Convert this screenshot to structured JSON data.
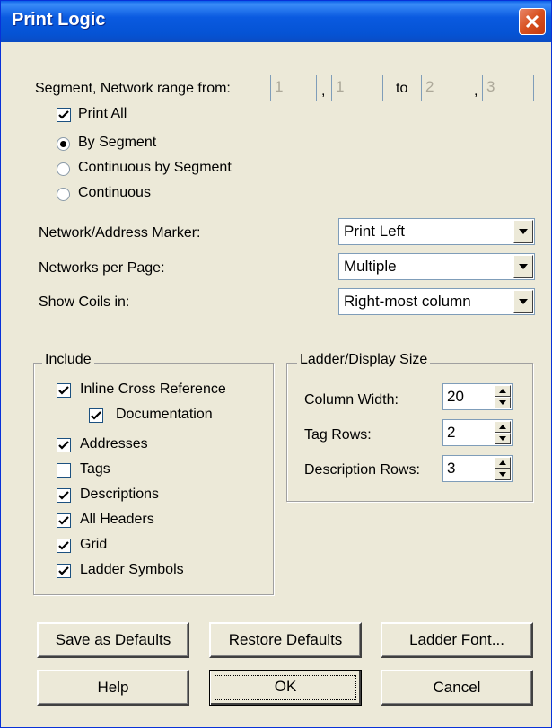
{
  "window": {
    "title": "Print Logic"
  },
  "range": {
    "label": "Segment, Network range from:",
    "from_segment": "1",
    "from_network": "1",
    "to_label": "to",
    "to_segment": "2",
    "to_network": "3",
    "comma": ","
  },
  "print_all": {
    "label": "Print All",
    "checked": true
  },
  "order": {
    "options": [
      {
        "label": "By Segment",
        "selected": true
      },
      {
        "label": "Continuous by Segment",
        "selected": false
      },
      {
        "label": "Continuous",
        "selected": false
      }
    ]
  },
  "marker": {
    "label": "Network/Address Marker:",
    "value": "Print Left"
  },
  "per_page": {
    "label": "Networks per Page:",
    "value": "Multiple"
  },
  "coils": {
    "label": "Show Coils in:",
    "value": "Right-most column"
  },
  "include": {
    "legend": "Include",
    "items": [
      {
        "label": "Inline Cross Reference",
        "checked": true
      },
      {
        "label": "Documentation",
        "checked": true
      },
      {
        "label": "Addresses",
        "checked": true
      },
      {
        "label": "Tags",
        "checked": false
      },
      {
        "label": "Descriptions",
        "checked": true
      },
      {
        "label": "All Headers",
        "checked": true
      },
      {
        "label": "Grid",
        "checked": true
      },
      {
        "label": "Ladder Symbols",
        "checked": true
      }
    ]
  },
  "display_size": {
    "legend": "Ladder/Display Size",
    "column_width": {
      "label": "Column Width:",
      "value": "20"
    },
    "tag_rows": {
      "label": "Tag Rows:",
      "value": "2"
    },
    "description_rows": {
      "label": "Description Rows:",
      "value": "3"
    }
  },
  "buttons": {
    "save_defaults": "Save as Defaults",
    "restore_defaults": "Restore Defaults",
    "ladder_font": "Ladder Font...",
    "help": "Help",
    "ok": "OK",
    "cancel": "Cancel"
  },
  "colors": {
    "titlebar": "#0553d4",
    "dialog_bg": "#ece9d8",
    "close": "#d8501f"
  }
}
